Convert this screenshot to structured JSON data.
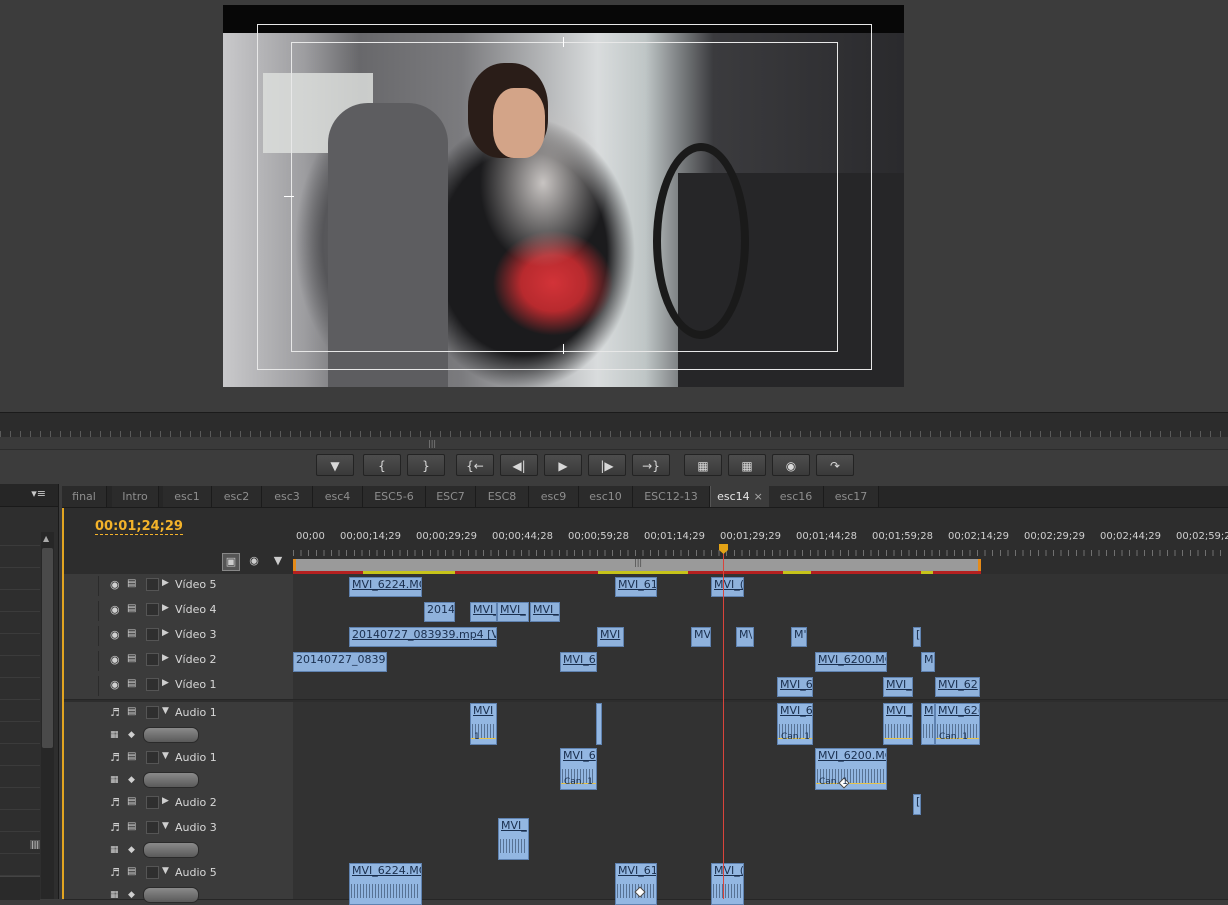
{
  "timeline": {
    "timecode": "00:01;24;29",
    "ruler_labels": [
      "00;00",
      "00;00;14;29",
      "00;00;29;29",
      "00;00;44;28",
      "00;00;59;28",
      "00;01;14;29",
      "00;01;29;29",
      "00;01;44;28",
      "00;01;59;28",
      "00;02;14;29",
      "00;02;29;29",
      "00;02;44;29",
      "00;02;59;2"
    ],
    "tabs": [
      {
        "label": "final",
        "active": false
      },
      {
        "label": "Intro",
        "active": false
      },
      {
        "label": "esc1",
        "active": false
      },
      {
        "label": "esc2",
        "active": false
      },
      {
        "label": "esc3",
        "active": false
      },
      {
        "label": "esc4",
        "active": false
      },
      {
        "label": "ESC5-6",
        "active": false
      },
      {
        "label": "ESC7",
        "active": false
      },
      {
        "label": "ESC8",
        "active": false
      },
      {
        "label": "esc9",
        "active": false
      },
      {
        "label": "esc10",
        "active": false
      },
      {
        "label": "ESC12-13",
        "active": false
      },
      {
        "label": "esc14",
        "active": true,
        "close": "×"
      },
      {
        "label": "esc16",
        "active": false
      },
      {
        "label": "esc17",
        "active": false
      }
    ],
    "tracks": [
      {
        "name": "Vídeo 5",
        "type": "video"
      },
      {
        "name": "Vídeo 4",
        "type": "video"
      },
      {
        "name": "Vídeo 3",
        "type": "video"
      },
      {
        "name": "Vídeo 2",
        "type": "video"
      },
      {
        "name": "Vídeo 1",
        "type": "video"
      },
      {
        "name": "Audio 1",
        "type": "audio"
      },
      {
        "name": "Audio 1",
        "type": "audio"
      },
      {
        "name": "Audio 2",
        "type": "audio_collapsed"
      },
      {
        "name": "Audio 3",
        "type": "audio"
      },
      {
        "name": "Audio 5",
        "type": "audio"
      }
    ],
    "clips": {
      "v5": [
        "MVI_6224.MC",
        "MVI_61",
        "MVI_("
      ],
      "v4": [
        "20140",
        "MVI_",
        "MVI_",
        "MVI_"
      ],
      "v3": [
        "20140727_083939.mp4 [V]",
        "MVI",
        "MV",
        "M\\",
        "M'",
        "["
      ],
      "v2": [
        "20140727_08393S",
        "MVI_6",
        "MVI_6200.MC",
        "M"
      ],
      "v1": [
        "MVI_6",
        "MVI_",
        "MVI_62"
      ],
      "a1": [
        "MVI",
        "MVI_6",
        "MVI_",
        "M",
        "MVI_62("
      ],
      "a1b": [
        "MVI_6",
        "MVI_6200.MC"
      ],
      "a2": [
        "["
      ],
      "a3": [
        "MVI_"
      ],
      "a5": [
        "MVI_6224.MC",
        "MVI_61",
        "MVI_("
      ]
    },
    "channel_label": "Can. 1",
    "channel_short": "1"
  },
  "transport": {
    "buttons": [
      "marker",
      "in",
      "out",
      "go-in",
      "step-back",
      "play",
      "step-fwd",
      "go-out",
      "lift",
      "extract",
      "export-frame",
      "button-editor"
    ]
  },
  "colors": {
    "accent": "#f4b32a",
    "clip_video": "#8fb2dc",
    "playhead": "#d9443b",
    "render_red": "#b52020",
    "render_yellow": "#c7c41a"
  }
}
